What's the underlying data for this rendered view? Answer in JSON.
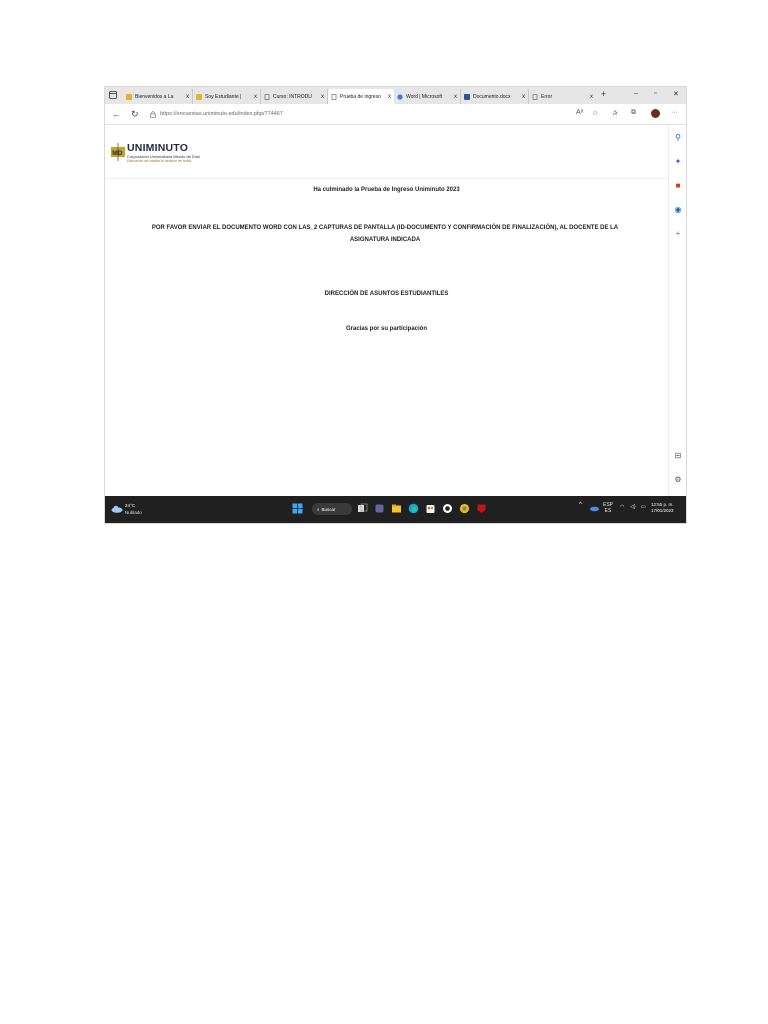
{
  "browser": {
    "tabs": [
      {
        "label": "Bienvenidos a La",
        "icon": "uniminuto-favicon",
        "active": false
      },
      {
        "label": "Soy Estudiante |",
        "icon": "uniminuto-favicon",
        "active": false
      },
      {
        "label": "Curso: INTRODU",
        "icon": "page-icon",
        "active": false
      },
      {
        "label": "Prueba de ingreso",
        "icon": "page-icon",
        "active": true
      },
      {
        "label": "Word | Microsoft",
        "icon": "ms-favicon",
        "active": false
      },
      {
        "label": "Documento.docx",
        "icon": "word-icon",
        "active": false
      },
      {
        "label": "Error",
        "icon": "page-icon",
        "active": false
      }
    ],
    "tab_close_glyph": "x",
    "new_tab_glyph": "+",
    "window": {
      "minimize": "–",
      "restore": "▫",
      "close": "✕"
    },
    "url": "https://encuestas.uniminuto.edu/index.php/774467",
    "more_glyph": "···"
  },
  "logo": {
    "name": "UNIMINUTO",
    "line1": "Corporación Universitaria Minuto de Dios",
    "line2": "Educación de calidad al alcance de todos"
  },
  "page": {
    "completed": "Ha culminado la Prueba de Ingreso Uniminuto 2023",
    "instruction": "POR FAVOR ENVIAR EL DOCUMENTO WORD CON LAS_2 CAPTURAS DE PANTALLA (ID-DOCUMENTO Y CONFIRMACIÓN DE FINALIZACIÓN),  AL DOCENTE DE LA ASIGNATURA INDICADA",
    "department": "DIRECCIÓN DE ASUNTOS ESTUDIANTILES",
    "thanks": "Gracias por su participación"
  },
  "taskbar": {
    "weather_temp": "24°C",
    "weather_desc": "Nublado",
    "search_label": "Buscar",
    "lang_top": "ESP",
    "lang_bottom": "ES",
    "time": "12:55 p. m.",
    "date": "17/01/2023"
  },
  "colors": {
    "accent_blue": "#0067c0",
    "logo_gold": "#c9a227",
    "taskbar_bg": "#202020"
  }
}
